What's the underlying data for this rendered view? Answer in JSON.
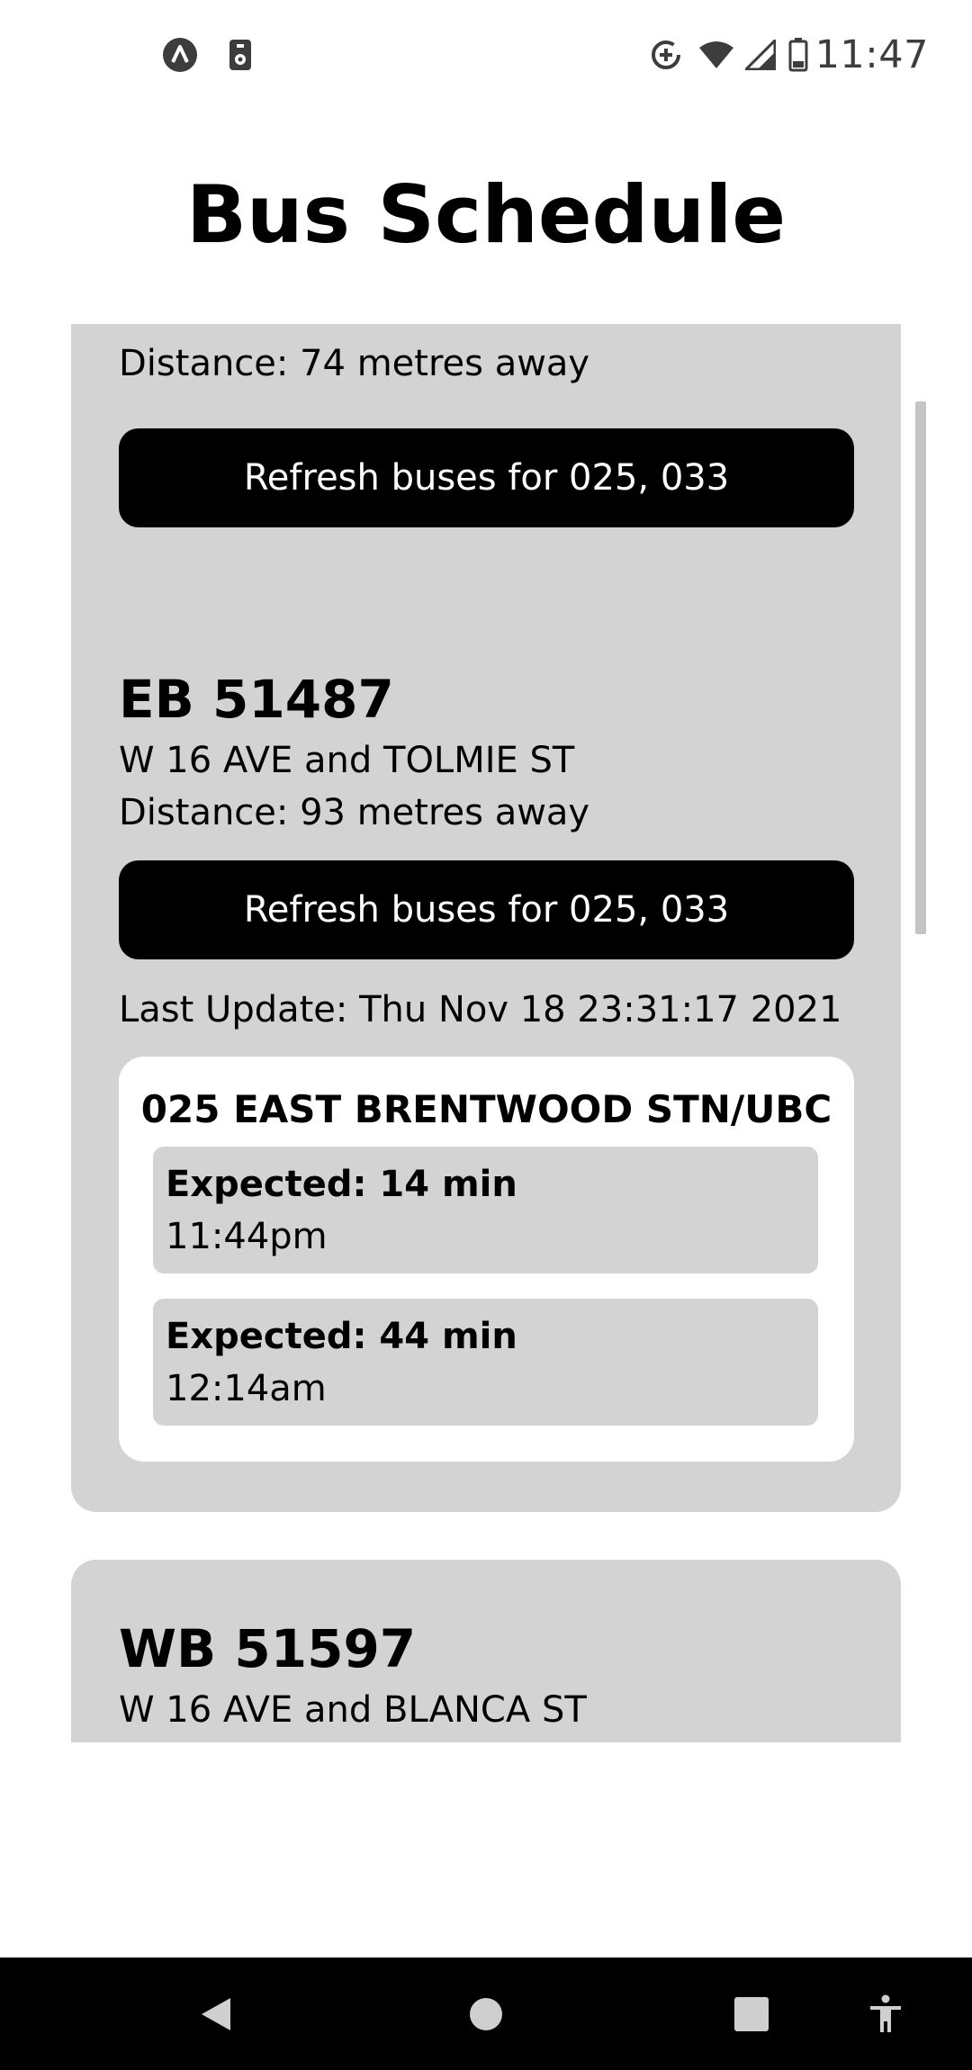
{
  "status_bar": {
    "time": "11:47",
    "left_icons": [
      "app-notification-icon",
      "storage-icon"
    ],
    "right_icons": [
      "data-saver-icon",
      "wifi-icon",
      "cell-signal-icon",
      "battery-icon"
    ]
  },
  "header": {
    "title": "Bus Schedule"
  },
  "stops": [
    {
      "distance": "Distance: 74 metres away",
      "refresh_label": "Refresh buses for 025, 033"
    },
    {
      "stop_id": "EB 51487",
      "name": "W 16 AVE and TOLMIE ST",
      "distance": "Distance: 93 metres away",
      "refresh_label": "Refresh buses for 025, 033",
      "last_update": "Last Update: Thu Nov 18 23:31:17 2021",
      "routes": [
        {
          "title": "025 EAST BRENTWOOD STN/UBC",
          "arrivals": [
            {
              "expected": "Expected: 14 min",
              "time": "11:44pm"
            },
            {
              "expected": "Expected: 44 min",
              "time": "12:14am"
            }
          ]
        }
      ]
    },
    {
      "stop_id": "WB 51597",
      "name": "W 16 AVE and BLANCA ST"
    }
  ],
  "nav_bar": {
    "icons": [
      "back-icon",
      "home-icon",
      "recents-icon",
      "accessibility-icon"
    ]
  },
  "colors": {
    "card_bg": "#d3d3d3",
    "button_bg": "#000000",
    "button_text": "#ffffff",
    "panel_bg": "#ffffff"
  }
}
